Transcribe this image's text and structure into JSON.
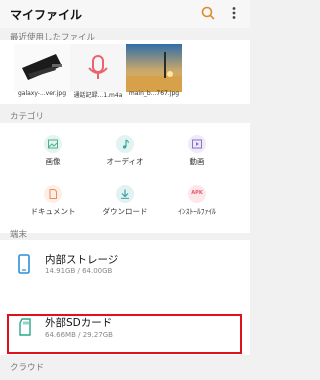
{
  "header": {
    "title": "マイファイル",
    "search_icon": "search-icon",
    "more_icon": "more-vert-icon"
  },
  "recent": {
    "label": "最近使用したファイル",
    "items": [
      {
        "name": "galaxy-...ver.jpg",
        "icon": "image-thumb"
      },
      {
        "name": "通話記録...1.m4a",
        "icon": "microphone-icon"
      },
      {
        "name": "main_b...767.jpg",
        "icon": "image-thumb"
      }
    ]
  },
  "categories": {
    "label": "カテゴリ",
    "items": [
      {
        "label": "画像",
        "icon": "image-icon",
        "color": "#4caf8e"
      },
      {
        "label": "オーディオ",
        "icon": "music-icon",
        "color": "#36a7a5"
      },
      {
        "label": "動画",
        "icon": "video-icon",
        "color": "#8a6fd0"
      },
      {
        "label": "ドキュメント",
        "icon": "document-icon",
        "color": "#f08a5d"
      },
      {
        "label": "ダウンロード",
        "icon": "download-icon",
        "color": "#3aa0a0"
      },
      {
        "label": "ｲﾝｽﾄｰﾙﾌｧｲﾙ",
        "icon": "apk-icon",
        "color": "#e8566a",
        "badge": "APK"
      }
    ]
  },
  "device": {
    "label": "端末",
    "items": [
      {
        "name": "内部ストレージ",
        "size": "14.91GB / 64.00GB",
        "icon": "phone-icon"
      },
      {
        "name": "外部SDカード",
        "size": "64.66MB / 29.27GB",
        "icon": "sd-card-icon"
      }
    ]
  },
  "cloud": {
    "label": "クラウド"
  }
}
